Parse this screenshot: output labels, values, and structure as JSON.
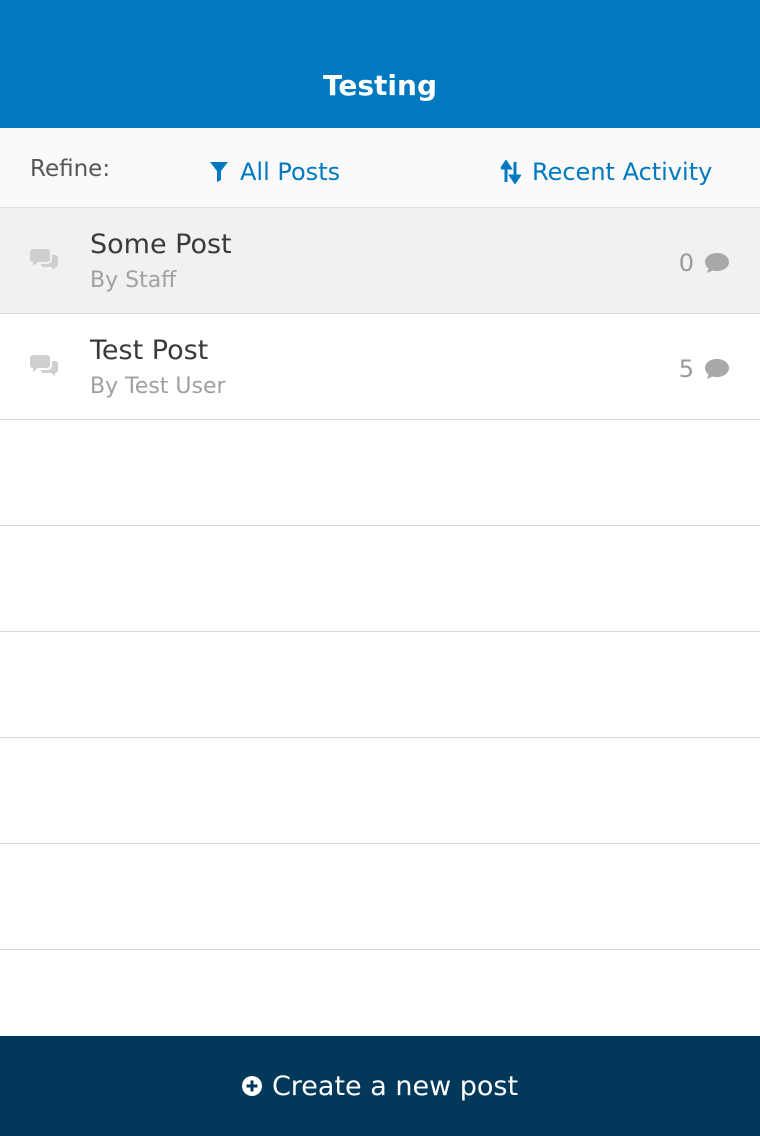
{
  "header": {
    "title": "Testing"
  },
  "refine": {
    "label": "Refine:",
    "filter_label": "All Posts",
    "filter_icon": "filter-icon",
    "sort_label": "Recent Activity",
    "sort_icon": "sort-icon"
  },
  "posts": [
    {
      "title": "Some Post",
      "author": "By Staff",
      "comment_count": "0",
      "selected": true
    },
    {
      "title": "Test Post",
      "author": "By Test User",
      "comment_count": "5",
      "selected": false
    }
  ],
  "footer": {
    "create_label": "Create a new post",
    "create_icon": "plus-circle-icon"
  },
  "colors": {
    "header_bg": "#0079c1",
    "accent": "#0079c1",
    "footer_bg": "#02385a",
    "selected_row_bg": "#f1f1f1"
  }
}
